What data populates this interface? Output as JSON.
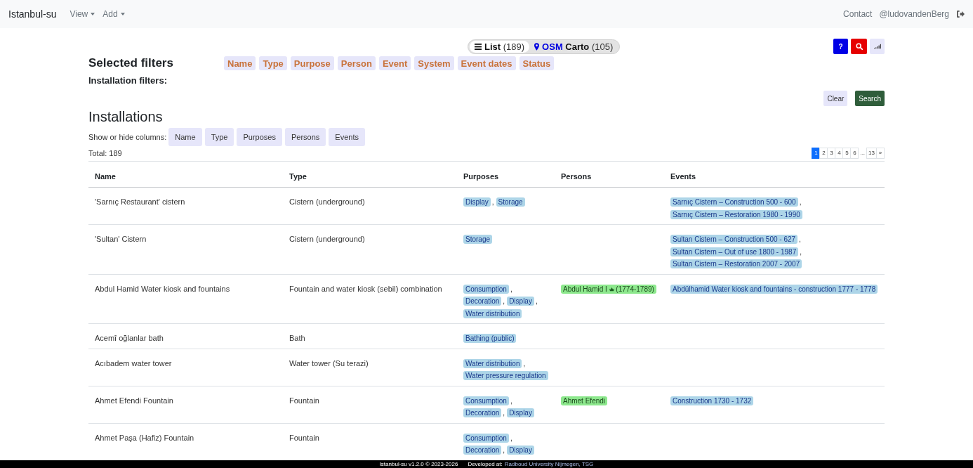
{
  "navbar": {
    "brand": "Istanbul-su",
    "menus": [
      {
        "label": "View"
      },
      {
        "label": "Add"
      }
    ],
    "links": [
      {
        "label": "Contact"
      },
      {
        "label": "@ludovandenBerg"
      }
    ]
  },
  "view_switch": [
    {
      "kind": "list",
      "label": "List",
      "count": "(189)",
      "selected": true
    },
    {
      "kind": "map",
      "source": "OSM",
      "label": "Carto",
      "count": "(105)",
      "selected": false
    }
  ],
  "tools": [
    {
      "kind": "help",
      "label": "?"
    },
    {
      "kind": "search"
    },
    {
      "kind": "stats"
    }
  ],
  "filters": {
    "title": "Selected filters",
    "chips": [
      "Name",
      "Type",
      "Purpose",
      "Person",
      "Event",
      "System",
      "Event dates",
      "Status"
    ],
    "subtitle": "Installation filters:",
    "actions": [
      {
        "kind": "secondary",
        "label": "Clear"
      },
      {
        "kind": "primary",
        "label": "Search"
      }
    ]
  },
  "installations": {
    "title": "Installations",
    "columns_label": "Show or hide columns:",
    "column_toggles": [
      "Name",
      "Type",
      "Purposes",
      "Persons",
      "Events"
    ],
    "total": "Total: 189",
    "pagination": [
      {
        "kind": "page",
        "label": "1",
        "selected": true
      },
      {
        "kind": "page",
        "label": "2",
        "selected": false
      },
      {
        "kind": "page",
        "label": "3",
        "selected": false
      },
      {
        "kind": "page",
        "label": "4",
        "selected": false
      },
      {
        "kind": "page",
        "label": "5",
        "selected": false
      },
      {
        "kind": "page",
        "label": "6",
        "selected": false
      },
      {
        "kind": "gap",
        "label": "...",
        "selected": false
      },
      {
        "kind": "page",
        "label": "13",
        "selected": false
      },
      {
        "kind": "page",
        "label": "»",
        "selected": false
      }
    ]
  },
  "table": {
    "columns": [
      "Name",
      "Type",
      "Purposes",
      "Persons",
      "Events"
    ],
    "separator": ",",
    "rows": [
      {
        "name": "'Sarnıç Restaurant' cistern",
        "type": "Cistern (underground)",
        "purposes": [
          "Display",
          "Storage"
        ],
        "events": [
          "Sarnıç Cistern – Construction 500 - 600",
          "Sarnıç Cistern – Restoration 1980 - 1990"
        ]
      },
      {
        "name": "'Sultan' Cistern",
        "type": "Cistern (underground)",
        "purposes": [
          "Storage"
        ],
        "events": [
          "Sultan Cistern – Construction 500 - 627",
          "Sultan Cistern – Out of use 1800 - 1987",
          "Sultan Cistern – Restoration 2007 - 2007"
        ]
      },
      {
        "name": "Abdul Hamid Water kiosk and fountains",
        "type": "Fountain and water kiosk (sebil) combination",
        "purposes": [
          "Consumption",
          "Decoration",
          "Display",
          "Water distribution"
        ],
        "persons": [
          {
            "name": "Abdul Hamid I",
            "ruler": true,
            "years": "(1774-1789)"
          }
        ],
        "events": [
          "Abdülhamid Water kiosk and fountains - construction 1777 - 1778"
        ]
      },
      {
        "name": "Acemî oğlanlar bath",
        "type": "Bath",
        "purposes": [
          "Bathing (public)"
        ]
      },
      {
        "name": "Acıbadem water tower",
        "type": "Water tower (Su terazi)",
        "purposes": [
          "Water distribution",
          "Water pressure regulation"
        ]
      },
      {
        "name": "Ahmet Efendi Fountain",
        "type": "Fountain",
        "purposes": [
          "Consumption",
          "Decoration",
          "Display"
        ],
        "persons": [
          {
            "name": "Ahmet Efendi",
            "ruler": false
          }
        ],
        "events": [
          "Construction 1730 - 1732"
        ]
      },
      {
        "name": "Ahmet Paşa (Hafiz) Fountain",
        "type": "Fountain",
        "purposes": [
          "Consumption",
          "Decoration",
          "Display"
        ]
      }
    ]
  },
  "footer": {
    "version": "Istanbul-su v1.2.0 © 2023-2026",
    "developed_label": "Developed at:",
    "developer": "Radboud University Nijmegen, TSG"
  }
}
